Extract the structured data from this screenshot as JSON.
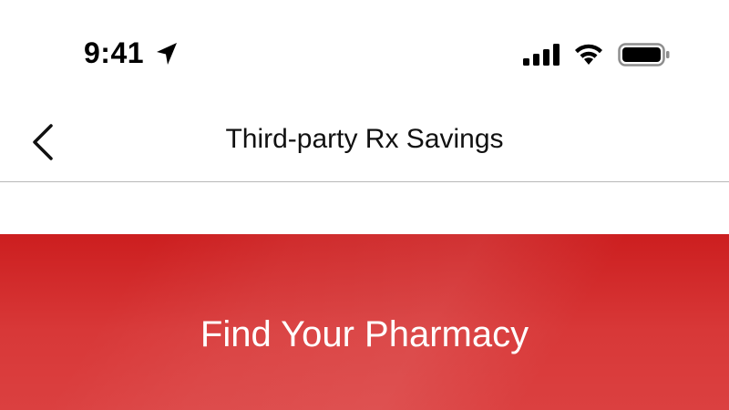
{
  "status_bar": {
    "time": "9:41",
    "icons": [
      "location-arrow-icon",
      "cellular-signal-icon",
      "wifi-icon",
      "battery-icon"
    ]
  },
  "nav": {
    "back_icon": "chevron-left-icon",
    "title": "Third-party Rx Savings"
  },
  "banner": {
    "title": "Find Your Pharmacy",
    "background_color": "#d42a2b",
    "text_color": "#ffffff"
  }
}
